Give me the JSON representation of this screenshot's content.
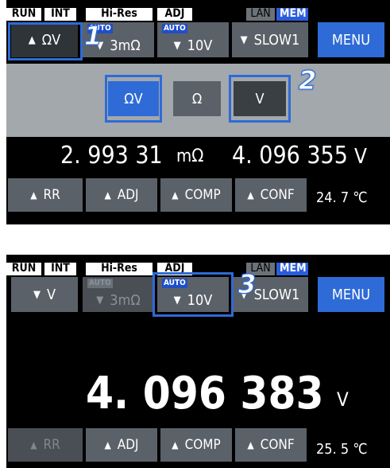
{
  "screens": [
    {
      "status": {
        "run": "RUN",
        "int": "INT",
        "hires": "Hi-Res",
        "adj": "ADJ",
        "lan": "LAN",
        "mem": "MEM"
      },
      "top_keys": {
        "mode": "ΩV",
        "auto_label": "AUTO",
        "range": "3mΩ",
        "v_auto_label": "AUTO",
        "v_range": "10V",
        "speed": "SLOW1",
        "menu": "MENU"
      },
      "selector": {
        "omega_v": "ΩV",
        "omega": "Ω",
        "volt": "V"
      },
      "reading_left": "2. 993 31",
      "reading_left_unit": "mΩ",
      "reading_right": "4. 096 355",
      "reading_right_unit": "V",
      "bottom_keys": {
        "rr": "RR",
        "adj": "ADJ",
        "comp": "COMP",
        "conf": "CONF"
      },
      "temperature": "24. 7 ℃",
      "callouts": [
        "1",
        "2"
      ]
    },
    {
      "status": {
        "run": "RUN",
        "int": "INT",
        "hires": "Hi-Res",
        "adj": "ADJ",
        "lan": "LAN",
        "mem": "MEM"
      },
      "top_keys": {
        "mode": "V",
        "auto_label": "AUTO",
        "range": "3mΩ",
        "v_auto_label": "AUTO",
        "v_range": "10V",
        "speed": "SLOW1",
        "menu": "MENU"
      },
      "reading": "4. 096 383",
      "reading_unit": "V",
      "bottom_keys": {
        "rr": "RR",
        "adj": "ADJ",
        "comp": "COMP",
        "conf": "CONF"
      },
      "temperature": "25. 5 ℃",
      "callouts": [
        "3"
      ]
    }
  ]
}
